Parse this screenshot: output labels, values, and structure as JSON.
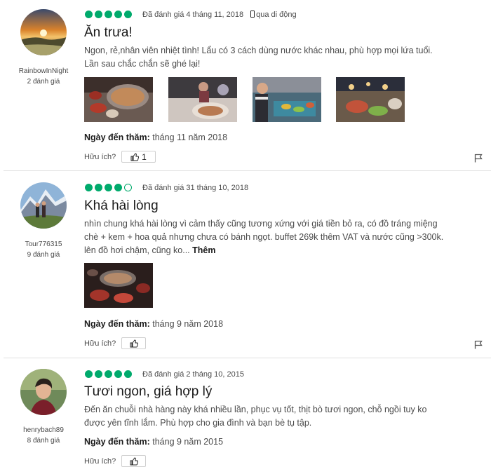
{
  "colors": {
    "bubble": "#00aa6c",
    "divider": "#e0e0e0"
  },
  "helpful_label": "Hữu ích?",
  "more_label": "Thêm",
  "visit_label": "Ngày đến thăm:",
  "reviews": [
    {
      "user": {
        "name": "RainbowInNight",
        "contributions": "2 đánh giá"
      },
      "rating": 5,
      "date": "Đã đánh giá 4 tháng 11, 2018",
      "via": "qua di động",
      "title": "Ăn trưa!",
      "text": "Ngon, rẻ,nhân viên nhiệt tình! Lẩu có 3 cách dùng nước khác nhau, phù hợp mọi lứa tuổi. Lần sau chắc chắn sẽ ghé lại!",
      "photos": 4,
      "visit_date": "tháng 11 năm 2018",
      "helpful_count": "1"
    },
    {
      "user": {
        "name": "Tour776315",
        "contributions": "9 đánh giá"
      },
      "rating": 4,
      "date": "Đã đánh giá 31 tháng 10, 2018",
      "title": "Khá hài lòng",
      "text": "nhìn chung khá hài lòng vì cảm thấy cũng tương xứng với giá tiền bỏ ra, có đồ tráng miệng chè + kem + hoa quả nhưng chưa có bánh ngọt. buffet 269k thêm VAT và nước cũng >300k. lên đồ hơi chậm, cũng ko...",
      "photos": 1,
      "visit_date": "tháng 9 năm 2018",
      "helpful_count": ""
    },
    {
      "user": {
        "name": "henrybach89",
        "contributions": "8 đánh giá"
      },
      "rating": 5,
      "date": "Đã đánh giá 2 tháng 10, 2015",
      "title": "Tươi ngon, giá hợp lý",
      "text": "Đến ăn chuỗi nhà hàng này khá nhiều lần, phục vụ tốt, thịt bò tươi ngon, chỗ ngồi tuy ko được yên tĩnh lắm. Phù hợp cho gia đình và bạn bè tụ tập.",
      "photos": 0,
      "visit_date": "tháng 9 năm 2015",
      "helpful_count": ""
    }
  ]
}
